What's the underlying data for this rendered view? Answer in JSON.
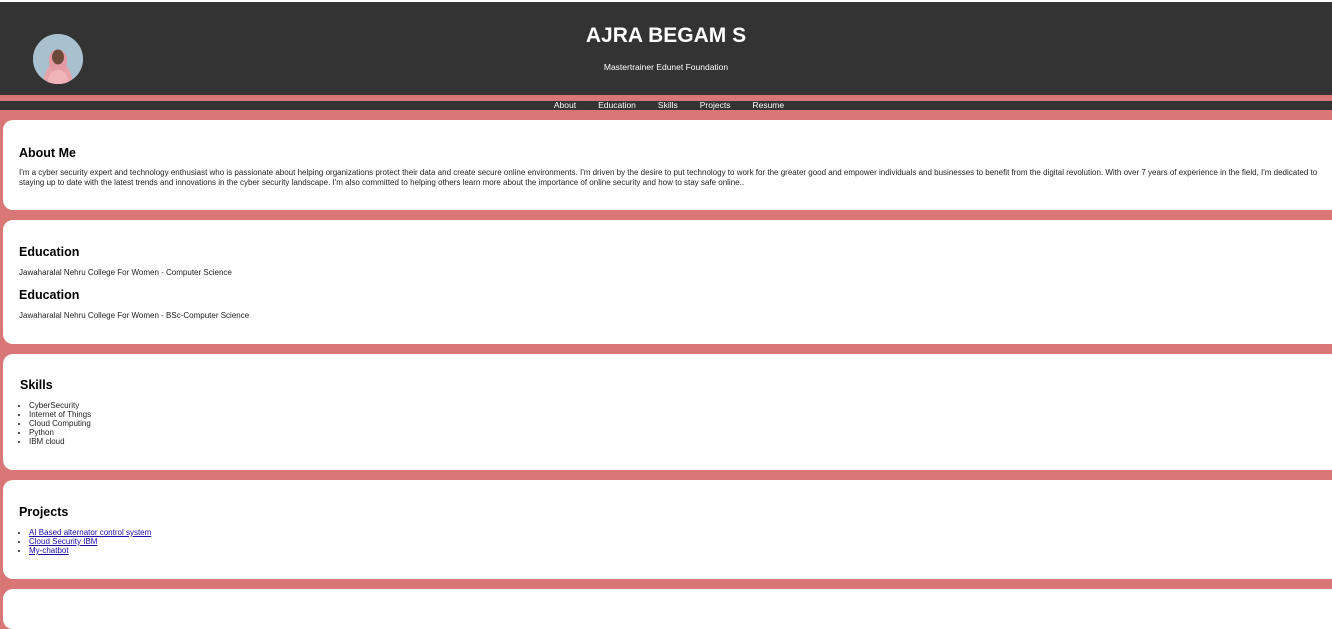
{
  "header": {
    "name": "AJRA BEGAM S",
    "subtitle": "Mastertrainer Edunet Foundation",
    "avatar_label": "profile photo"
  },
  "nav": {
    "items": [
      "About",
      "Education",
      "Skills",
      "Projects",
      "Resume"
    ]
  },
  "about": {
    "heading": "About Me",
    "text": "I'm a cyber security expert and technology enthusiast who is passionate about helping organizations protect their data and create secure online environments. I'm driven by the desire to put technology to work for the greater good and empower individuals and businesses to benefit from the digital revolution. With over 7 years of experience in the field, I'm dedicated to staying up to date with the latest trends and innovations in the cyber security landscape. I'm also committed to helping others learn more about the importance of online security and how to stay safe online.."
  },
  "education": [
    {
      "heading": "Education",
      "text": "Jawaharalal Nehru College For Women - Computer Science"
    },
    {
      "heading": "Education",
      "text": "Jawaharalal Nehru College For Women - BSc-Computer Science"
    }
  ],
  "skills": {
    "heading": "Skills",
    "items": [
      "CyberSecurity",
      "Internet of Things",
      "Cloud Computing",
      "Python",
      "IBM cloud"
    ]
  },
  "projects": {
    "heading": "Projects",
    "items": [
      "AI Based alternator control system",
      "Cloud Security IBM",
      "My-chatbot"
    ]
  },
  "colors": {
    "header_bg": "#333333",
    "page_bg": "#d97777",
    "card_bg": "#ffffff",
    "link": "#1a0dab"
  }
}
